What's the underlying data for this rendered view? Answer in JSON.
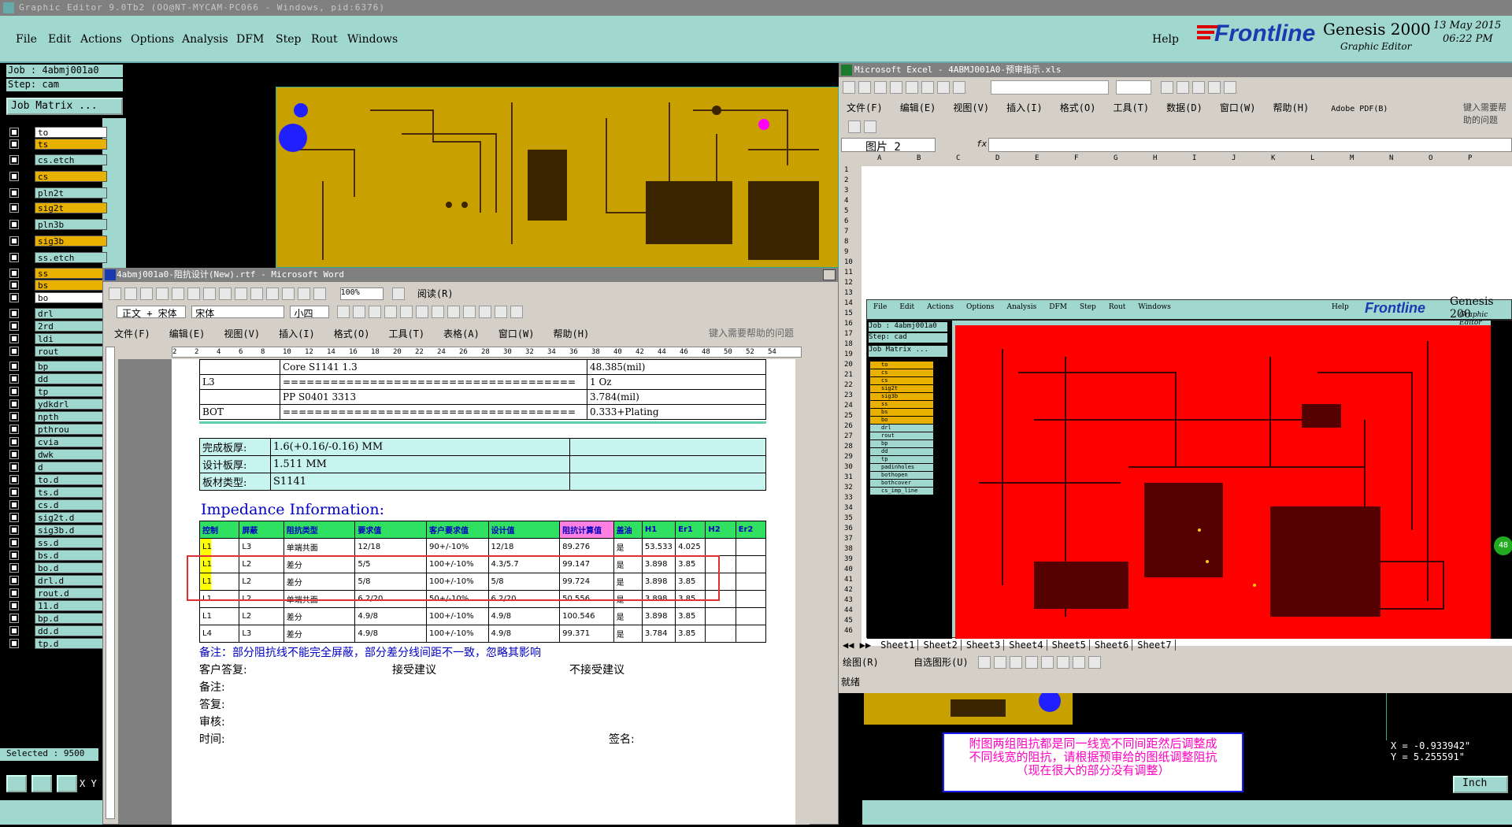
{
  "genesis": {
    "title": "Graphic Editor 9.0Tb2 (OO@NT-MYCAM-PC066 - Windows, pid:6376)",
    "menu": [
      "File",
      "Edit",
      "Actions",
      "Options",
      "Analysis",
      "DFM",
      "Step",
      "Rout",
      "Windows"
    ],
    "help": "Help",
    "brand": "Frontline",
    "product": "Genesis 2000",
    "subtitle": "Graphic Editor",
    "date": "13 May 2015",
    "time": "06:22 PM",
    "job": "Job : 4abmj001a0",
    "step": "Step: cam",
    "job_matrix": "Job Matrix ...",
    "layers": [
      "to",
      "ts",
      "cs.etch",
      "cs",
      "pln2t",
      "sig2t",
      "pln3b",
      "sig3b",
      "ss.etch",
      "ss",
      "bs",
      "bo",
      "drl",
      "2rd",
      "ldi",
      "rout",
      "bp",
      "dd",
      "tp",
      "ydkdrl",
      "npth",
      "pthrou",
      "cvia",
      "dwk",
      "d",
      "to.d",
      "ts.d",
      "cs.d",
      "sig2t.d",
      "sig3b.d",
      "ss.d",
      "bs.d",
      "bo.d",
      "drl.d",
      "rout.d",
      "11.d",
      "bp.d",
      "dd.d",
      "tp.d"
    ],
    "selected": "Selected : 9500",
    "coords": {
      "x": "X = -0.933942\"",
      "y": "Y = 5.255591\""
    },
    "unit": "Inch",
    "xy_label": "X Y",
    "note": [
      "附图两组阻抗都是同一线宽不同间距然后调整成",
      "不同线宽的阻抗，请根据预审给的图纸调整阻抗",
      "（现在很大的部分没有调整）"
    ],
    "colors": {
      "bg": "#a0d8d0",
      "board": "#c8a000",
      "red": "#ff0000"
    }
  },
  "word": {
    "title": "4abmj001a0-阻抗设计(New).rtf - Microsoft Word",
    "menu": [
      "文件(F)",
      "编辑(E)",
      "视图(V)",
      "插入(I)",
      "格式(O)",
      "工具(T)",
      "表格(A)",
      "窗口(W)",
      "帮助(H)"
    ],
    "help_box": "键入需要帮助的问题",
    "zoom": "100%",
    "read": "阅读(R)",
    "style": "正文 + 宋体",
    "font": "宋体",
    "size": "小四",
    "ruler": [
      "2",
      "2",
      "4",
      "6",
      "8",
      "10",
      "12",
      "14",
      "16",
      "18",
      "20",
      "22",
      "24",
      "26",
      "28",
      "30",
      "32",
      "34",
      "36",
      "38",
      "40",
      "42",
      "44",
      "46",
      "48",
      "50",
      "52",
      "54"
    ],
    "stack": [
      [
        "",
        "Core",
        "S1141",
        "1.3",
        "48.385(mil)"
      ],
      [
        "L3",
        "=====================================",
        "",
        "",
        "1 Oz"
      ],
      [
        "",
        "PP",
        "S0401",
        "3313",
        "3.784(mil)"
      ],
      [
        "BOT",
        "=====================================",
        "",
        "",
        "0.333+Plating"
      ]
    ],
    "info": [
      [
        "完成板厚:",
        "1.6(+0.16/-0.16) MM"
      ],
      [
        "设计板厚:",
        "1.511 MM"
      ],
      [
        "板材类型:",
        "S1141"
      ]
    ],
    "imp_title": "Impedance Information:",
    "imp_head": [
      "控制",
      "屏蔽",
      "阻抗类型",
      "要求值",
      "客户要求值",
      "设计值",
      "阻抗计算值",
      "盖油",
      "H1",
      "Er1",
      "H2",
      "Er2"
    ],
    "imp_rows": [
      [
        "L1",
        "L3",
        "单端共面",
        "12/18",
        "90+/-10%",
        "12/18",
        "89.276",
        "是",
        "53.533",
        "4.025",
        "",
        ""
      ],
      [
        "L1",
        "L2",
        "差分",
        "5/5",
        "100+/-10%",
        "4.3/5.7",
        "99.147",
        "是",
        "3.898",
        "3.85",
        "",
        ""
      ],
      [
        "L1",
        "L2",
        "差分",
        "5/8",
        "100+/-10%",
        "5/8",
        "99.724",
        "是",
        "3.898",
        "3.85",
        "",
        ""
      ],
      [
        "L1",
        "L2",
        "单端共面",
        "6.2/20",
        "50+/-10%",
        "6.2/20",
        "50.556",
        "是",
        "3.898",
        "3.85",
        "",
        ""
      ],
      [
        "L1",
        "L2",
        "差分",
        "4.9/8",
        "100+/-10%",
        "4.9/8",
        "100.546",
        "是",
        "3.898",
        "3.85",
        "",
        ""
      ],
      [
        "L4",
        "L3",
        "差分",
        "4.9/8",
        "100+/-10%",
        "4.9/8",
        "99.371",
        "是",
        "3.784",
        "3.85",
        "",
        ""
      ]
    ],
    "remark": "备注：部分阻抗线不能完全屏蔽，部分差分线间距不一致，忽略其影响",
    "reply": "客户答复:",
    "accept": "接受建议",
    "reject": "不接受建议",
    "footer": [
      "备注:",
      "答复:",
      "审核:",
      "时间:"
    ],
    "sign": "签名:"
  },
  "excel": {
    "title": "Microsoft Excel - 4ABMJ001A0-预审指示.xls",
    "menu": [
      "文件(F)",
      "编辑(E)",
      "视图(V)",
      "插入(I)",
      "格式(O)",
      "工具(T)",
      "数据(D)",
      "窗口(W)",
      "帮助(H)",
      "Adobe PDF(B)"
    ],
    "help_box": "键入需要帮助的问题",
    "namebox": "图片 2",
    "fx": "fx",
    "cols": [
      "A",
      "B",
      "C",
      "D",
      "E",
      "F",
      "G",
      "H",
      "I",
      "J",
      "K",
      "L",
      "M",
      "N",
      "O",
      "P"
    ],
    "rows": [
      "1",
      "2",
      "3",
      "4",
      "5",
      "6",
      "7",
      "8",
      "9",
      "10",
      "11",
      "12",
      "13",
      "14",
      "15",
      "16",
      "17",
      "18",
      "19",
      "20",
      "21",
      "22",
      "23",
      "24",
      "25",
      "26",
      "27",
      "28",
      "29",
      "30",
      "31",
      "32",
      "33",
      "34",
      "35",
      "36",
      "37",
      "38",
      "39",
      "40",
      "41",
      "42",
      "43",
      "44",
      "45",
      "46"
    ],
    "sheets": [
      "Sheet1",
      "Sheet2",
      "Sheet3",
      "Sheet4",
      "Sheet5",
      "Sheet6",
      "Sheet7"
    ],
    "draw": "绘图(R)",
    "autoshape": "自选图形(U)",
    "status": "就绪",
    "inner": {
      "menu": [
        "File",
        "Edit",
        "Actions",
        "Options",
        "Analysis",
        "DFM",
        "Step",
        "Rout",
        "Windows"
      ],
      "help": "Help",
      "job": "Job : 4abmj001a0",
      "step": "Step: cad",
      "matrix": "Job Matrix ...",
      "layers": [
        "to",
        "cs",
        "cs",
        "sig2t",
        "sig3b",
        "ss",
        "bs",
        "bo",
        "drl",
        "rout",
        "bp",
        "dd",
        "tp",
        "padinholes",
        "bothopen",
        "bothcover",
        "cs_imp_line"
      ],
      "brand": "Frontline",
      "product": "Genesis 200",
      "sub": "Graphic Editor",
      "badge": "48"
    }
  }
}
